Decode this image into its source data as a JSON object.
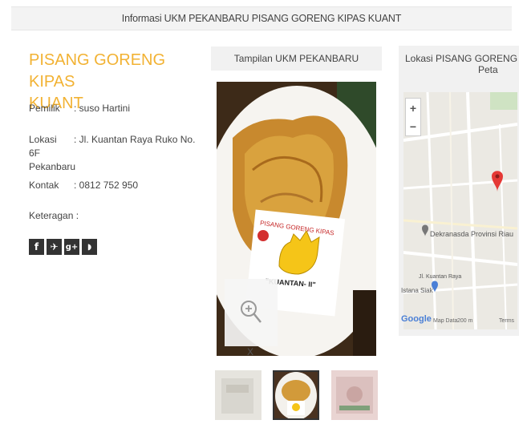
{
  "header": {
    "title": "Informasi UKM PEKANBARU PISANG GORENG KIPAS KUANT"
  },
  "profile": {
    "name_line1": "PISANG GORENG KIPAS",
    "name_line2": "KUANT",
    "owner_label": "Pemilik",
    "owner_value": ": suso Hartini",
    "location_label": "Lokasi",
    "location_value": ": Jl. Kuantan Raya Ruko No. 6F",
    "location_value2": "Pekanbaru",
    "contact_label": "Kontak",
    "contact_value": ": 0812 752 950",
    "note_label": "Keteragan :"
  },
  "social": [
    {
      "icon": "facebook-icon",
      "glyph": "f"
    },
    {
      "icon": "twitter-icon",
      "glyph": "✈"
    },
    {
      "icon": "google-plus-icon",
      "glyph": "g+"
    },
    {
      "icon": "rss-icon",
      "glyph": "◗"
    }
  ],
  "gallery": {
    "heading": "Tampilan UKM PEKANBARU",
    "close_glyph": "X",
    "sign_text": "PISANG GORENG KIPAS",
    "sign_text2": "\"KUANTAN- II\""
  },
  "map": {
    "heading_line1": "Lokasi PISANG GORENG KI",
    "heading_line2": "Peta",
    "zoom_in": "+",
    "zoom_out": "−",
    "place_label": "Dekranasda Provinsi Riau",
    "road_label": "Jl. Kuantan Raya",
    "poi_label": "Istana Siak",
    "footer_data": "Map Data",
    "footer_scale": "200 m",
    "footer_terms": "Terms",
    "brand": "Google"
  },
  "colors": {
    "accent": "#f2b233",
    "pin": "#e53935"
  }
}
